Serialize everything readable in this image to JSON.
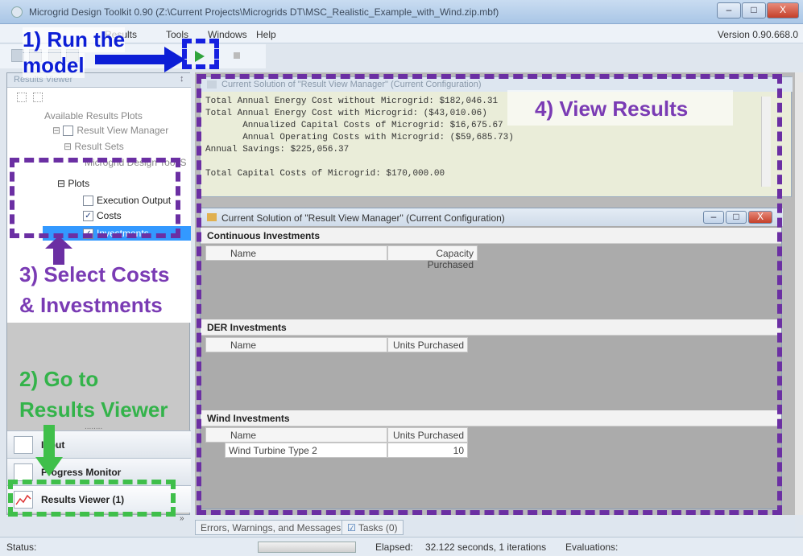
{
  "window": {
    "title": "Microgrid Design Toolkit 0.90 (Z:\\Current Projects\\Microgrids DT\\MSC_Realistic_Example_with_Wind.zip.mbf)",
    "minimize": "–",
    "maximize": "□",
    "close": "X"
  },
  "menu": {
    "results": "Results",
    "tools": "Tools",
    "windows": "Windows",
    "help": "Help",
    "version": "Version 0.90.668.0"
  },
  "left_panel": {
    "title": "Results Viewer",
    "pin": "↕",
    "tree": {
      "root": "Available Results Plots",
      "manager": "Result View Manager",
      "result_sets": "Result Sets",
      "result_set_item": "Microgrid Design Tool S",
      "plots": "Plots",
      "execution_output": "Execution Output",
      "costs": "Costs",
      "investments": "Investments"
    },
    "nav": {
      "input": "Input",
      "progress_monitor": "Progress Monitor",
      "results_viewer": "Results Viewer (1)"
    },
    "splitter": "........"
  },
  "top_window": {
    "title": "Current Solution of \"Result View Manager\" (Current Configuration)",
    "lines": [
      "Total Annual Energy Cost without Microgrid: $182,046.31",
      "Total Annual Energy Cost with Microgrid: ($43,010.06)",
      "       Annualized Capital Costs of Microgrid: $16,675.67",
      "       Annual Operating Costs with Microgrid: ($59,685.73)",
      "Annual Savings: $225,056.37",
      "",
      "Total Capital Costs of Microgrid: $170,000.00"
    ]
  },
  "result_window": {
    "title": "Current Solution of \"Result View Manager\" (Current Configuration)",
    "continuous": {
      "header": "Continuous Investments",
      "col_name": "Name",
      "col_value": "Capacity Purchased"
    },
    "der": {
      "header": "DER Investments",
      "col_name": "Name",
      "col_value": "Units Purchased"
    },
    "wind": {
      "header": "Wind Investments",
      "col_name": "Name",
      "col_value": "Units Purchased",
      "rows": [
        {
          "name": "Wind Turbine Type 2",
          "units": "10"
        }
      ]
    }
  },
  "bottom_tabs": {
    "errors": "Errors, Warnings, and Messages",
    "tasks": "Tasks (0)"
  },
  "status": {
    "label": "Status:",
    "elapsed_label": "Elapsed:",
    "elapsed_value": "32.122 seconds, 1 iterations",
    "evaluations": "Evaluations:"
  },
  "annotations": {
    "run_model_1": "1) Run the",
    "run_model_2": "model",
    "select_costs_1": "3) Select Costs",
    "select_costs_2": "& Investments",
    "go_to_1": "2) Go to",
    "go_to_2": "Results Viewer",
    "view_results": "4) View Results"
  },
  "colors": {
    "annotation_blue": "#0c1ed6",
    "annotation_purple": "#7a3bb4",
    "annotation_green": "#33b34a",
    "selection": "#3399ff"
  }
}
